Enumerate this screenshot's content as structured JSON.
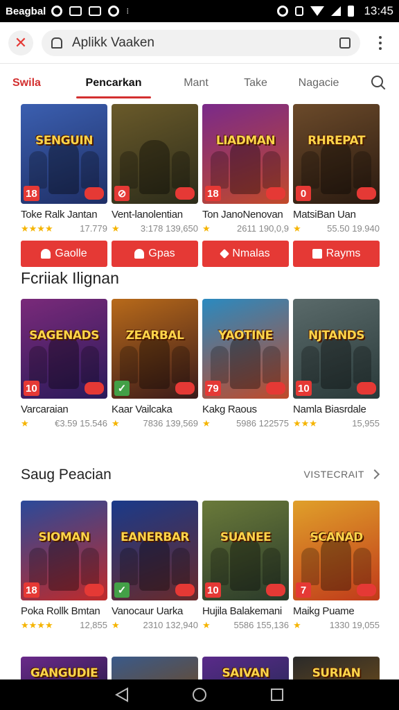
{
  "status_bar": {
    "carrier": "Beagbal",
    "time": "13:45",
    "left_icons": [
      "whatsapp-icon",
      "mail-icon",
      "download-icon",
      "record-icon",
      "sync-icon"
    ],
    "right_icons": [
      "alarm-icon",
      "lock-icon",
      "wifi-icon",
      "signal-icon",
      "battery-icon"
    ]
  },
  "toolbar": {
    "close_label": "✕",
    "url_text": "Aplikk Vaaken"
  },
  "category_tabs": [
    {
      "label": "Swila",
      "state": "red"
    },
    {
      "label": "Pencarkan",
      "state": "active"
    },
    {
      "label": "Mant",
      "state": ""
    },
    {
      "label": "Take",
      "state": ""
    },
    {
      "label": "Nagacie",
      "state": ""
    }
  ],
  "rows": [
    {
      "games": [
        {
          "cover_title": "SENGUIN",
          "name": "Toke Ralk Jantan",
          "stars": "★★★★",
          "rating": "17.779",
          "age": "18",
          "bg": [
            "#3b5fb0",
            "#1f2f66"
          ]
        },
        {
          "cover_title": "",
          "name": "Vent-lanolentian",
          "stars": "★",
          "rating": "3:178  139,650",
          "age": "⊘",
          "bg": [
            "#6a5a2a",
            "#2c2c1a"
          ]
        },
        {
          "cover_title": "LIADMAN",
          "name": "Ton JanoNenovan",
          "stars": "★",
          "rating": "2611  190,0,9",
          "age": "18",
          "bg": [
            "#7a2a8a",
            "#c24a2a"
          ]
        },
        {
          "cover_title": "RHREPAT",
          "name": "MatsiBan Uan",
          "stars": "★",
          "rating": "55.50  19.940",
          "age": "0",
          "bg": [
            "#6b4a2a",
            "#2a1a10"
          ]
        }
      ]
    },
    {
      "games": [
        {
          "cover_title": "SAGENADS",
          "name": "Varcaraian",
          "stars": "★",
          "rating": "€3.59  15.546",
          "age": "10",
          "bg": [
            "#7a2a7a",
            "#2a1a5a"
          ]
        },
        {
          "cover_title": "ZEARBAL",
          "name": "Kaar Vailcaka",
          "stars": "★",
          "rating": "7836  139,569",
          "age": "✓",
          "bg": [
            "#b86a1a",
            "#3a1a1a"
          ]
        },
        {
          "cover_title": "YAOTINE",
          "name": "Kakg Raous",
          "stars": "★",
          "rating": "5986  122575",
          "age": "79",
          "bg": [
            "#2a8ac0",
            "#c04a2a"
          ]
        },
        {
          "cover_title": "NJTANDS",
          "name": "Namla Biasrdale",
          "stars": "★★★",
          "rating": "15,955",
          "age": "10",
          "bg": [
            "#5a6a6a",
            "#2a3a3a"
          ]
        }
      ]
    },
    {
      "games": [
        {
          "cover_title": "SIOMAN",
          "name": "Poka Rollk Bmtan",
          "stars": "★★★★",
          "rating": "12,855",
          "age": "18",
          "bg": [
            "#2a4a9a",
            "#c02a2a"
          ]
        },
        {
          "cover_title": "EANERBAR",
          "name": "Vanocaur Uarka",
          "stars": "★",
          "rating": "2310  132,940",
          "age": "✓",
          "bg": [
            "#1a3a8a",
            "#6a2a2a"
          ]
        },
        {
          "cover_title": "SUANEE",
          "name": "Hujila Balakemani",
          "stars": "★",
          "rating": "5586  155,136",
          "age": "10",
          "bg": [
            "#6a7a3a",
            "#2a3a2a"
          ]
        },
        {
          "cover_title": "SCANAD",
          "name": "Maikg Puame",
          "stars": "★",
          "rating": "1330  19,055",
          "age": "7",
          "bg": [
            "#e0a02a",
            "#c03a1a"
          ]
        }
      ]
    }
  ],
  "actions": [
    {
      "label": "Gaolle",
      "icon": "user-icon"
    },
    {
      "label": "Gpas",
      "icon": "ghost-icon"
    },
    {
      "label": "Nmalas",
      "icon": "upload-icon"
    },
    {
      "label": "Rayms",
      "icon": "bag-icon"
    }
  ],
  "section1": {
    "title": "Fcriiak Ilignan"
  },
  "section2": {
    "title": "Saug Peacian",
    "link": "VISTECRAIT"
  },
  "partial_covers": [
    {
      "cover_title": "GANGUDIE",
      "bg": [
        "#6a2a8a",
        "#2a1a4a"
      ]
    },
    {
      "cover_title": "",
      "bg": [
        "#3a5a8a",
        "#6a4a2a"
      ]
    },
    {
      "cover_title": "SAIVAN",
      "bg": [
        "#5a2a8a",
        "#2a2a5a"
      ]
    },
    {
      "cover_title": "SURIAN",
      "bg": [
        "#2a2a2a",
        "#6a4a1a"
      ]
    }
  ],
  "colors": {
    "accent": "#e53935",
    "star": "#f5b400"
  }
}
